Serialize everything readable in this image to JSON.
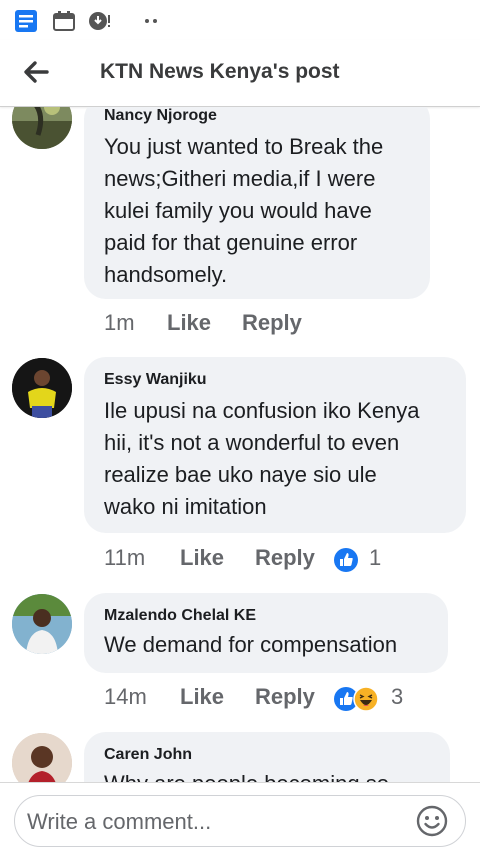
{
  "status_bar": {
    "icons": [
      "news-feed-icon",
      "calendar-icon",
      "download-icon",
      "more-dots-icon"
    ]
  },
  "header": {
    "title": "KTN News Kenya's post",
    "back_icon": "back-arrow-icon"
  },
  "comments": [
    {
      "author": "Nancy Njoroge",
      "lines": [
        "You just wanted to Break the",
        "news;Githeri media,if I were",
        "kulei family you would have",
        "paid for that genuine error",
        "handsomely."
      ],
      "time": "1m",
      "like": "Like",
      "reply": "Reply"
    },
    {
      "author": "Essy Wanjiku",
      "lines": [
        "Ile upusi na confusion iko Kenya",
        "hii, it's not a wonderful to even",
        "realize bae uko naye sio ule",
        "wako ni imitation"
      ],
      "time": "11m",
      "like": "Like",
      "reply": "Reply",
      "reaction_count": "1",
      "reactions": [
        "like-reaction-icon"
      ]
    },
    {
      "author": "Mzalendo Chelal KE",
      "lines": [
        "We demand for compensation"
      ],
      "time": "14m",
      "like": "Like",
      "reply": "Reply",
      "reaction_count": "3",
      "reactions": [
        "like-reaction-icon",
        "haha-reaction-icon"
      ]
    },
    {
      "author": "Caren John",
      "lines": [
        "Why are people becoming so"
      ]
    }
  ],
  "composer": {
    "placeholder": "Write a comment...",
    "emoji_icon": "emoji-icon"
  },
  "colors": {
    "accent": "#1877f2",
    "bubble": "#f0f2f5",
    "secondary_text": "#65676b"
  }
}
